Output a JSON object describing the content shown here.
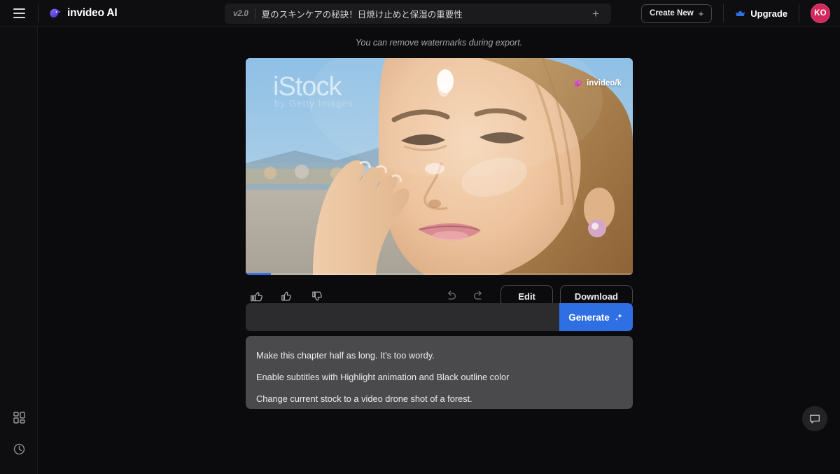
{
  "header": {
    "menu_icon": "hamburger-icon",
    "brand": "invideo AI",
    "brand_logo_icon": "invideo-logo-icon",
    "version": "v2.0",
    "project_title": "夏のスキンケアの秘訣！日焼け止めと保湿の重要性",
    "new_tab_icon": "plus-icon",
    "create_new_label": "Create New",
    "create_new_icon": "plus-icon",
    "upgrade_label": "Upgrade",
    "upgrade_icon": "crown-icon",
    "avatar_initials": "KO",
    "avatar_color": "#d32a5e"
  },
  "rail": {
    "items": [
      {
        "name": "dashboard",
        "icon": "grid-icon"
      },
      {
        "name": "history",
        "icon": "clock-icon"
      }
    ]
  },
  "main": {
    "watermark_note": "You can remove watermarks during export."
  },
  "video": {
    "stock_watermark": "iStock",
    "stock_watermark_sub": "by Getty Images",
    "brand_watermark": "invideo/k",
    "progress_percent": 6.5,
    "progress_color": "#2f6fe4"
  },
  "controls": {
    "reactions": [
      {
        "name": "super-like",
        "icon": "thumbs-up-double-icon"
      },
      {
        "name": "like",
        "icon": "thumbs-up-icon"
      },
      {
        "name": "dislike",
        "icon": "thumbs-down-icon"
      }
    ],
    "undo_icon": "undo-arrow-icon",
    "redo_icon": "redo-arrow-icon",
    "edit_label": "Edit",
    "download_label": "Download"
  },
  "prompt": {
    "value": "",
    "placeholder": "",
    "generate_label": "Generate",
    "generate_icon": "sparkle-icon",
    "generate_color": "#2f6fe4"
  },
  "suggestions": [
    "Make this chapter half as long. It's too wordy.",
    "Enable subtitles with Highlight animation and Black outline color",
    "Change current stock to a video drone shot of a forest."
  ],
  "support": {
    "icon": "chat-bubble-icon"
  }
}
